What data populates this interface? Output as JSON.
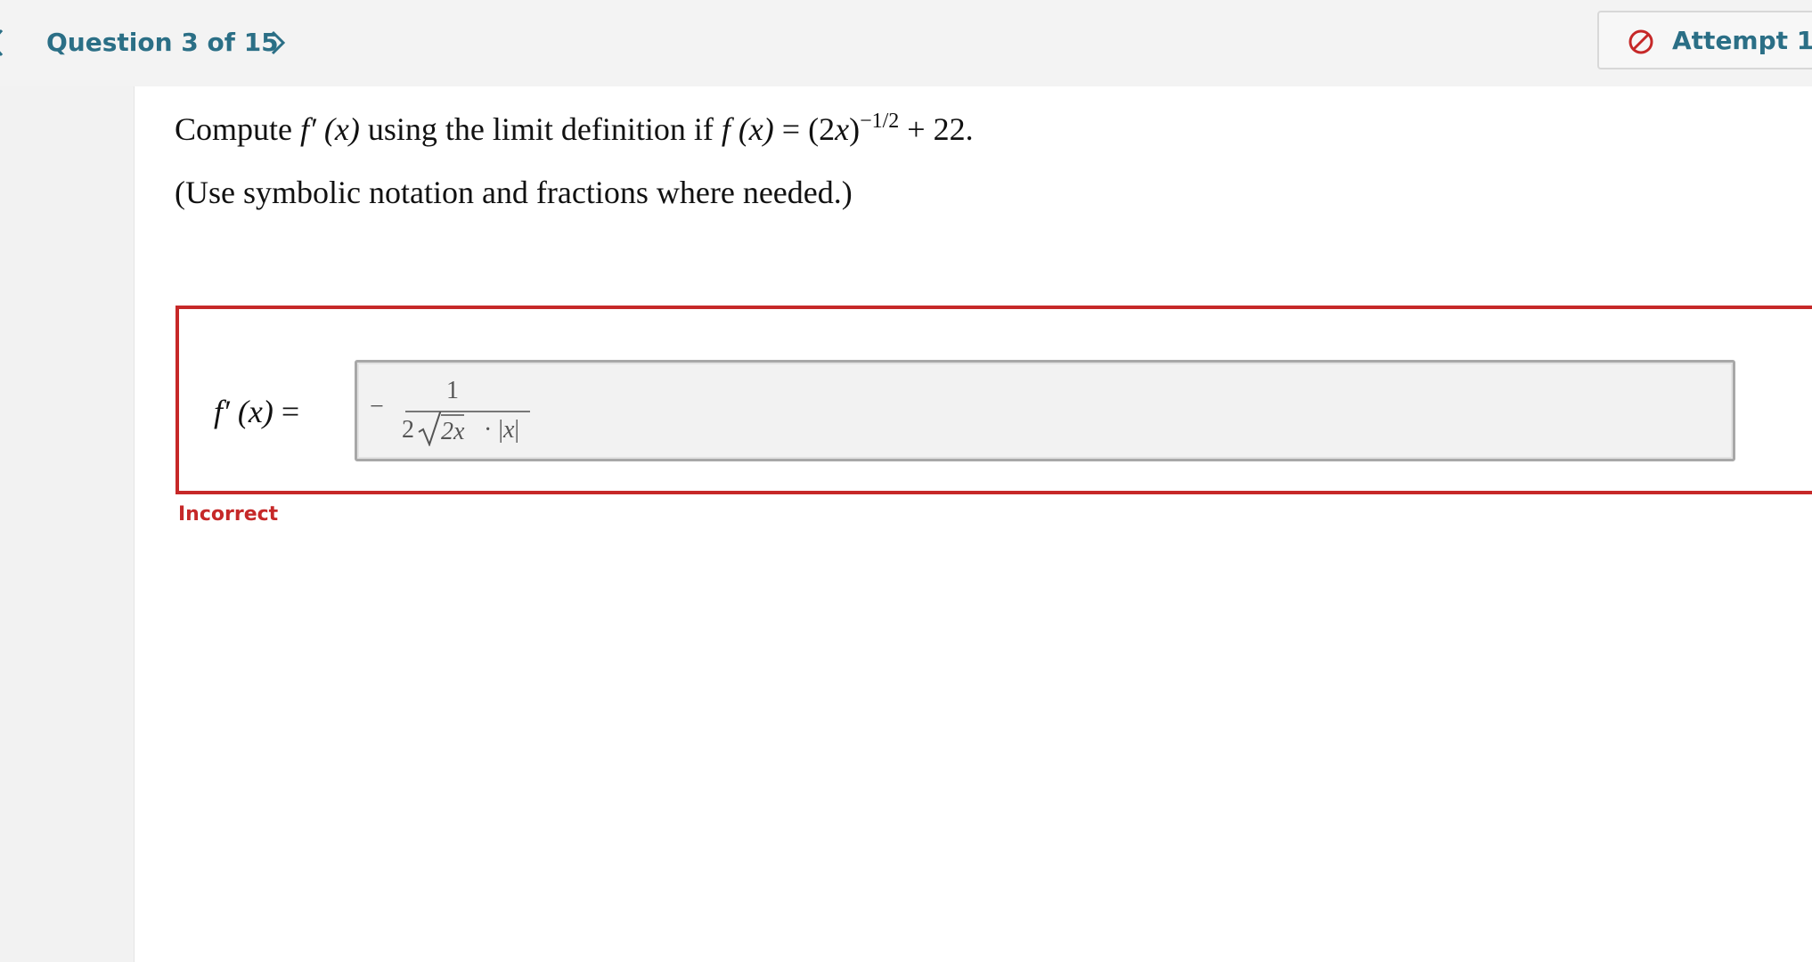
{
  "header": {
    "question_counter": "Question 3 of 15",
    "attempt_label": "Attempt 1"
  },
  "question": {
    "prompt_pre": "Compute ",
    "prompt_fprime": "f′ (x)",
    "prompt_mid": " using the limit definition if ",
    "prompt_fx": "f (x)",
    "prompt_eq": " = (2",
    "prompt_x": "x",
    "prompt_close": ")",
    "prompt_exponent": "−1/2",
    "prompt_tail": " + 22.",
    "hint": "(Use symbolic notation and fractions where needed.)"
  },
  "answer": {
    "label_fprime": "f′ (x)",
    "label_eq": " =",
    "entered": {
      "sign": "−",
      "numerator": "1",
      "coefficient": "2",
      "radicand": "2x",
      "rest_dot": "· |",
      "rest_var": "x",
      "rest_close": "|"
    },
    "feedback": "Incorrect"
  },
  "colors": {
    "accent": "#2b6f86",
    "error": "#c62828",
    "input_bg": "#f2f2f2"
  },
  "icons": {
    "prev": "chevron-left-icon",
    "next": "chevron-right-icon",
    "attempt": "prohibited-icon"
  }
}
